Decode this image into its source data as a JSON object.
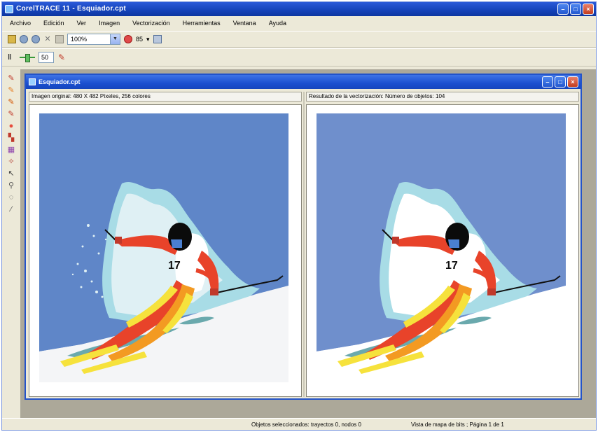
{
  "app": {
    "title": "CorelTRACE 11 - Esquiador.cpt"
  },
  "menu": [
    "Archivo",
    "Edición",
    "Ver",
    "Imagen",
    "Vectorización",
    "Herramientas",
    "Ventana",
    "Ayuda"
  ],
  "toolbar": {
    "zoom_value": "100%",
    "color_count_label": "85",
    "smoothing_value": "50"
  },
  "document": {
    "title": "Esquiador.cpt",
    "left_header": "Imagen original:  480 X 482 Píxeles, 256 colores",
    "right_header": "Resultado de la vectorización:  Número de objetos: 104"
  },
  "status": {
    "selection": "Objetos seleccionados: trayectos 0, nodos 0",
    "view": "Vista de mapa de bits ; Página 1 de 1"
  },
  "colors": {
    "sky": "#5f86c8",
    "sky_traced": "#6f8fcc",
    "snow_glow": "#dff0f4",
    "snow_mid": "#a8dce6",
    "suit_red": "#e8432a",
    "suit_orange": "#f39a22",
    "suit_yellow": "#f6e23c",
    "helmet": "#0b0b0b",
    "shadow": "#6aa9ad"
  }
}
